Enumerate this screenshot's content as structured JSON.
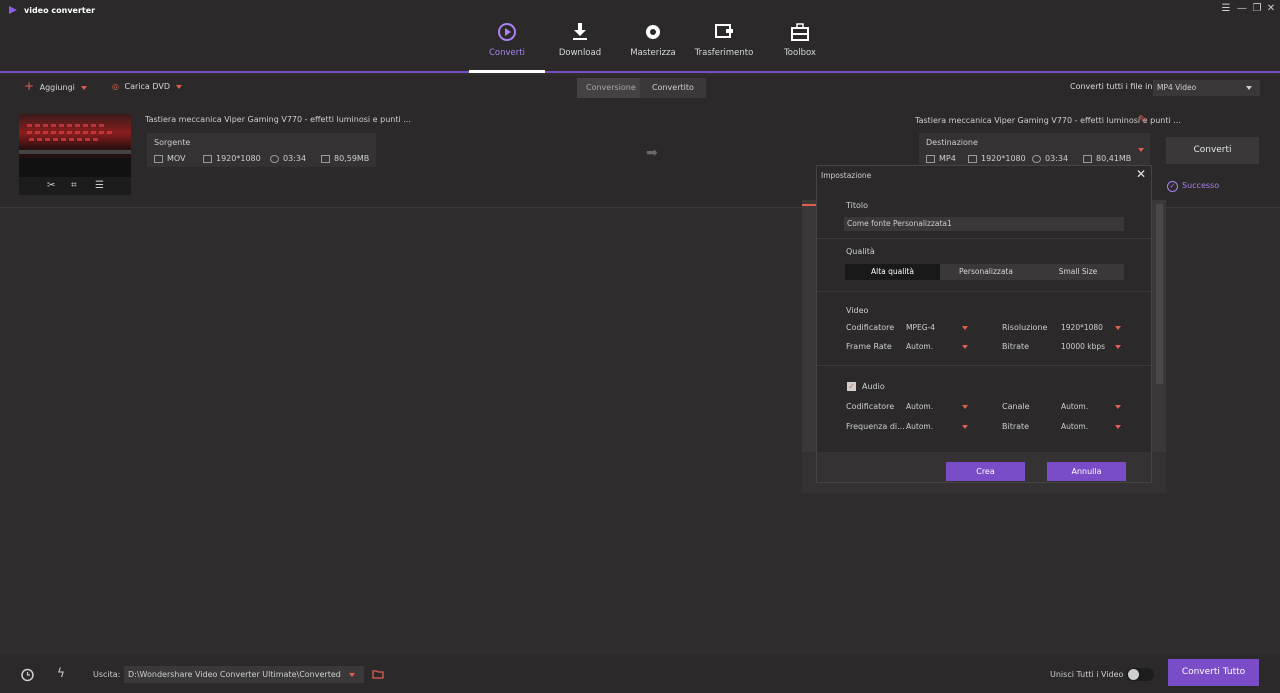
{
  "app": {
    "title": "video converter"
  },
  "nav": {
    "tabs": [
      {
        "label": "Converti",
        "icon": "play-circle-icon",
        "active": true
      },
      {
        "label": "Download",
        "icon": "download-icon",
        "active": false
      },
      {
        "label": "Masterizza",
        "icon": "disc-icon",
        "active": false
      },
      {
        "label": "Trasferimento",
        "icon": "transfer-icon",
        "active": false
      },
      {
        "label": "Toolbox",
        "icon": "toolbox-icon",
        "active": false
      }
    ]
  },
  "window": {
    "menu": "☰",
    "minimize": "—",
    "restore": "❐",
    "close": "✕"
  },
  "toolbar": {
    "add_label": "Aggiungi",
    "load_dvd_label": "Carica DVD",
    "segments": [
      "Conversione",
      "Convertito"
    ],
    "convert_all_in_label": "Converti tutti i file in:",
    "format_value": "MP4 Video"
  },
  "file": {
    "title_source": "Tastiera meccanica Viper Gaming V770 - effetti luminosi e punti ...",
    "title_dest": "Tastiera meccanica Viper Gaming V770 - effetti luminosi e punti ...",
    "source_label": "Sorgente",
    "source": {
      "format": "MOV",
      "resolution": "1920*1080",
      "duration": "03:34",
      "size": "80,59MB"
    },
    "dest_label": "Destinazione",
    "dest": {
      "format": "MP4",
      "resolution": "1920*1080",
      "duration": "03:34",
      "size": "80,41MB"
    },
    "convert_button": "Converti",
    "status": "Successo"
  },
  "dialog": {
    "title": "Impostazione",
    "titolo_label": "Titolo",
    "titolo_value": "Come fonte Personalizzata1",
    "quality_label": "Qualità",
    "quality_options": [
      "Alta qualità",
      "Personalizzata",
      "Small Size"
    ],
    "video_label": "Video",
    "codificatore_label": "Codificatore",
    "codificatore_value": "MPEG-4",
    "risoluzione_label": "Risoluzione",
    "risoluzione_value": "1920*1080",
    "frame_rate_label": "Frame Rate",
    "frame_rate_value": "Autom.",
    "bitrate_label": "Bitrate",
    "bitrate_value": "10000 kbps",
    "audio_label": "Audio",
    "audio_codificatore_label": "Codificatore",
    "audio_codificatore_value": "Autom.",
    "canale_label": "Canale",
    "canale_value": "Autom.",
    "frequenza_label": "Frequenza di...",
    "frequenza_value": "Autom.",
    "audio_bitrate_label": "Bitrate",
    "audio_bitrate_value": "Autom.",
    "create_button": "Crea",
    "cancel_button": "Annulla"
  },
  "bottom": {
    "output_label": "Uscita:",
    "output_path": "D:\\Wondershare Video Converter Ultimate\\Converted",
    "merge_label": "Unisci Tutti i Video",
    "convert_all_button": "Converti Tutto"
  },
  "colors": {
    "accent": "#7b4cc7",
    "active_tab": "#a983f2",
    "caret": "#e06050"
  }
}
